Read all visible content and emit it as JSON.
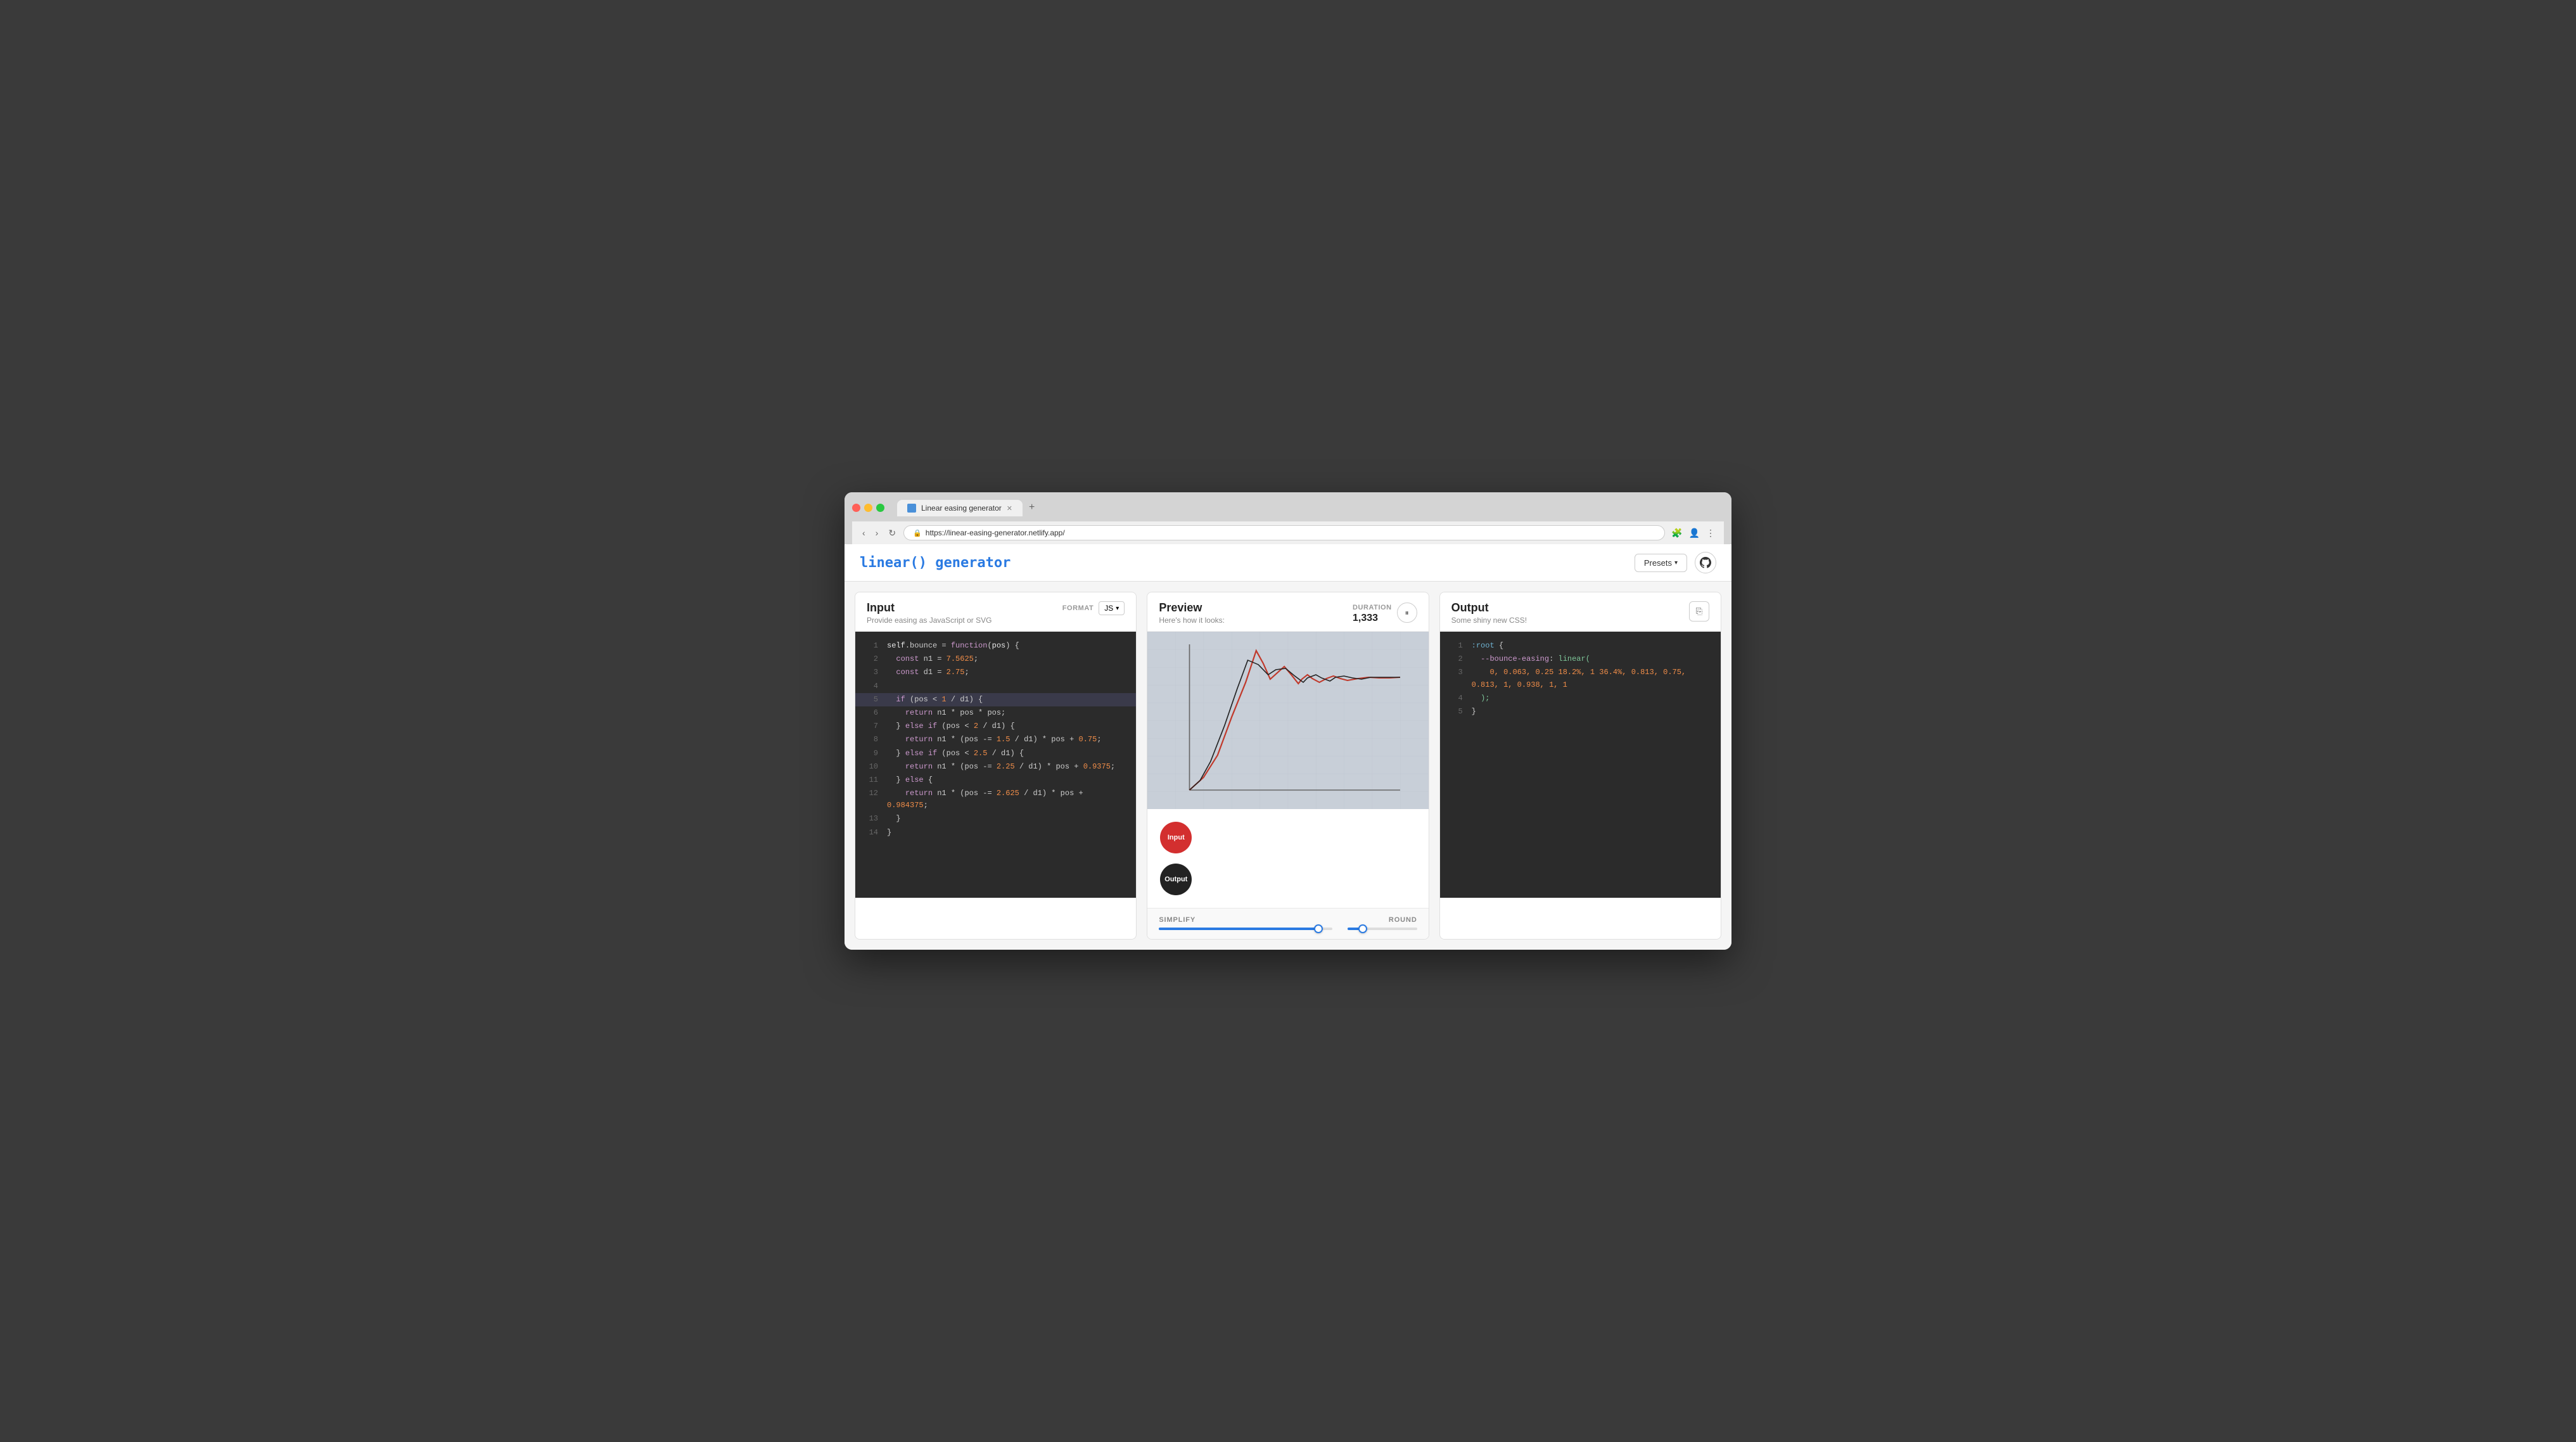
{
  "browser": {
    "url": "https://linear-easing-generator.netlify.app/",
    "tab_title": "Linear easing generator",
    "new_tab_icon": "+"
  },
  "app": {
    "logo": "linear() generator",
    "header": {
      "presets_label": "Presets",
      "github_icon": "github"
    }
  },
  "input_panel": {
    "title": "Input",
    "subtitle": "Provide easing as JavaScript or SVG",
    "format_label": "FORMAT",
    "format_value": "JS",
    "code_lines": [
      {
        "num": 1,
        "text": "self.bounce = function(pos) {"
      },
      {
        "num": 2,
        "text": "  const n1 = 7.5625;"
      },
      {
        "num": 3,
        "text": "  const d1 = 2.75;"
      },
      {
        "num": 4,
        "text": ""
      },
      {
        "num": 5,
        "text": "  if (pos < 1 / d1) {",
        "highlight": true
      },
      {
        "num": 6,
        "text": "    return n1 * pos * pos;"
      },
      {
        "num": 7,
        "text": "  } else if (pos < 2 / d1) {"
      },
      {
        "num": 8,
        "text": "    return n1 * (pos -= 1.5 / d1) * pos + 0.75;"
      },
      {
        "num": 9,
        "text": "  } else if (pos < 2.5 / d1) {"
      },
      {
        "num": 10,
        "text": "    return n1 * (pos -= 2.25 / d1) * pos + 0.9375;"
      },
      {
        "num": 11,
        "text": "  } else {"
      },
      {
        "num": 12,
        "text": "    return n1 * (pos -= 2.625 / d1) * pos + 0.984375;"
      },
      {
        "num": 13,
        "text": "  }"
      },
      {
        "num": 14,
        "text": "}"
      }
    ]
  },
  "preview_panel": {
    "title": "Preview",
    "subtitle": "Here's how it looks:",
    "duration_label": "DURATION",
    "duration_value": "1,333",
    "play_pause_icon": "pause",
    "ball_input_label": "Input",
    "ball_output_label": "Output",
    "simplify_label": "SIMPLIFY",
    "round_label": "ROUND",
    "simplify_pct": 92,
    "round_pct": 22
  },
  "output_panel": {
    "title": "Output",
    "subtitle": "Some shiny new CSS!",
    "copy_icon": "copy",
    "code_lines": [
      {
        "num": 1,
        "text": ":root {"
      },
      {
        "num": 2,
        "text": "  --bounce-easing: linear("
      },
      {
        "num": 3,
        "text": "    0, 0.063, 0.25 18.2%, 1 36.4%, 0.813, 0.75, 0.813, 1, 0.938, 1, 1"
      },
      {
        "num": 4,
        "text": "  );"
      },
      {
        "num": 5,
        "text": "}"
      }
    ]
  }
}
